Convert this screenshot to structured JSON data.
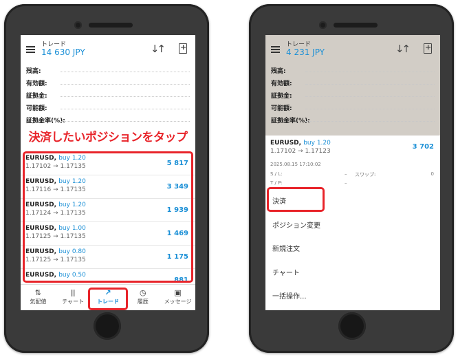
{
  "left_screen": {
    "header": {
      "title": "トレード",
      "balance": "14 630 JPY"
    },
    "summary": [
      "残高:",
      "有効額:",
      "証拠金:",
      "可能額:",
      "証拠金率(%):"
    ],
    "callout": "決済したいポジションをタップ",
    "positions": [
      {
        "symbol": "EURUSD,",
        "side": "buy 1.20",
        "prices": "1.17102 → 1.17135",
        "profit": "5 817"
      },
      {
        "symbol": "EURUSD,",
        "side": "buy 1.20",
        "prices": "1.17116 → 1.17135",
        "profit": "3 349"
      },
      {
        "symbol": "EURUSD,",
        "side": "buy 1.20",
        "prices": "1.17124 → 1.17135",
        "profit": "1 939"
      },
      {
        "symbol": "EURUSD,",
        "side": "buy 1.00",
        "prices": "1.17125 → 1.17135",
        "profit": "1 469"
      },
      {
        "symbol": "EURUSD,",
        "side": "buy 0.80",
        "prices": "1.17125 → 1.17135",
        "profit": "1 175"
      },
      {
        "symbol": "EURUSD,",
        "side": "buy 0.50",
        "prices": "",
        "profit": "881"
      }
    ],
    "nav": [
      {
        "icon": "⇅",
        "label": "気配値"
      },
      {
        "icon": "ǀǀ",
        "label": "チャート"
      },
      {
        "icon": "↗",
        "label": "トレード"
      },
      {
        "icon": "◷",
        "label": "履歴"
      },
      {
        "icon": "▣",
        "label": "メッセージ"
      }
    ]
  },
  "right_screen": {
    "header": {
      "title": "トレード",
      "balance": "4 231 JPY"
    },
    "summary": [
      "残高:",
      "有効額:",
      "証拠金:",
      "可能額:",
      "証拠金率(%):"
    ],
    "position": {
      "symbol": "EURUSD,",
      "side": "buy 1.20",
      "prices": "1.17102 → 1.17123",
      "profit": "3 702",
      "date": "2025.08.15 17:10:02",
      "sl_label": "S / L:",
      "sl_value": "–",
      "swap_label": "スワップ:",
      "swap_value": "0",
      "tp_label": "T / P:",
      "tp_value": "–"
    },
    "menu": [
      "決済",
      "ポジション変更",
      "新規注文",
      "チャート",
      "一括操作..."
    ]
  },
  "colors": {
    "accent": "#1a8fd6",
    "highlight": "#e8242a",
    "phone_body": "#3a3a3a"
  }
}
